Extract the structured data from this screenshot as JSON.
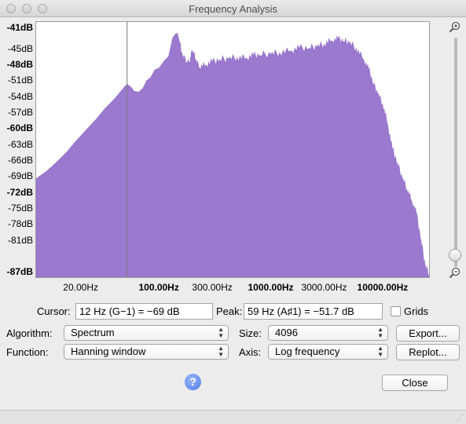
{
  "window": {
    "title": "Frequency Analysis"
  },
  "chart_data": {
    "type": "area",
    "xscale": "log",
    "xlim": [
      8,
      26000
    ],
    "ylim": [
      -88,
      -40
    ],
    "color": "#9b79cf",
    "cursor_hz": 12,
    "y_tick_labels": [
      {
        "value": -41,
        "label": "-41dB",
        "bold": true
      },
      {
        "value": -45,
        "label": "-45dB",
        "bold": false
      },
      {
        "value": -48,
        "label": "-48dB",
        "bold": true
      },
      {
        "value": -51,
        "label": "-51dB",
        "bold": false
      },
      {
        "value": -54,
        "label": "-54dB",
        "bold": false
      },
      {
        "value": -57,
        "label": "-57dB",
        "bold": false
      },
      {
        "value": -60,
        "label": "-60dB",
        "bold": true
      },
      {
        "value": -63,
        "label": "-63dB",
        "bold": false
      },
      {
        "value": -66,
        "label": "-66dB",
        "bold": false
      },
      {
        "value": -69,
        "label": "-69dB",
        "bold": false
      },
      {
        "value": -72,
        "label": "-72dB",
        "bold": true
      },
      {
        "value": -75,
        "label": "-75dB",
        "bold": false
      },
      {
        "value": -78,
        "label": "-78dB",
        "bold": false
      },
      {
        "value": -81,
        "label": "-81dB",
        "bold": false
      },
      {
        "value": -87,
        "label": "-87dB",
        "bold": true
      }
    ],
    "x_tick_labels": [
      {
        "value": 20,
        "label": "20.00Hz",
        "bold": false
      },
      {
        "value": 100,
        "label": "100.00Hz",
        "bold": true
      },
      {
        "value": 300,
        "label": "300.00Hz",
        "bold": false
      },
      {
        "value": 1000,
        "label": "1000.00Hz",
        "bold": true
      },
      {
        "value": 3000,
        "label": "3000.00Hz",
        "bold": false
      },
      {
        "value": 10000,
        "label": "10000.00Hz",
        "bold": true
      }
    ],
    "points": [
      [
        8,
        -69.5
      ],
      [
        10,
        -68
      ],
      [
        12,
        -66.5
      ],
      [
        15,
        -64.5
      ],
      [
        18,
        -62.5
      ],
      [
        22,
        -60.5
      ],
      [
        27,
        -58.5
      ],
      [
        33,
        -56.3
      ],
      [
        40,
        -54.5
      ],
      [
        48,
        -52.5
      ],
      [
        52,
        -51.7
      ],
      [
        56,
        -52.2
      ],
      [
        60,
        -53
      ],
      [
        66,
        -53.2
      ],
      [
        72,
        -52.5
      ],
      [
        78,
        -51
      ],
      [
        84,
        -50.5
      ],
      [
        92,
        -49
      ],
      [
        100,
        -48.7
      ],
      [
        112,
        -47.3
      ],
      [
        122,
        -46.5
      ],
      [
        133,
        -43
      ],
      [
        140,
        -42.3
      ],
      [
        146,
        -42.1
      ],
      [
        152,
        -43.5
      ],
      [
        162,
        -46.5
      ],
      [
        178,
        -47.5
      ],
      [
        188,
        -47.8
      ],
      [
        196,
        -46
      ],
      [
        204,
        -45.8
      ],
      [
        214,
        -47.5
      ],
      [
        232,
        -48.5
      ],
      [
        260,
        -48.2
      ],
      [
        300,
        -47.6
      ],
      [
        350,
        -47.1
      ],
      [
        420,
        -47
      ],
      [
        500,
        -46.7
      ],
      [
        600,
        -46.9
      ],
      [
        700,
        -46.4
      ],
      [
        800,
        -46.2
      ],
      [
        1000,
        -46.1
      ],
      [
        1200,
        -45.8
      ],
      [
        1500,
        -45.5
      ],
      [
        1800,
        -45
      ],
      [
        2200,
        -44.9
      ],
      [
        2600,
        -44.7
      ],
      [
        3000,
        -44.2
      ],
      [
        3500,
        -43.6
      ],
      [
        4000,
        -43.3
      ],
      [
        4500,
        -43.6
      ],
      [
        5000,
        -44
      ],
      [
        5800,
        -45
      ],
      [
        6700,
        -47
      ],
      [
        7500,
        -49
      ],
      [
        8200,
        -51.5
      ],
      [
        9000,
        -53.5
      ],
      [
        10000,
        -55.5
      ],
      [
        11000,
        -59
      ],
      [
        12200,
        -64
      ],
      [
        13500,
        -66.5
      ],
      [
        15000,
        -69.5
      ],
      [
        16500,
        -71.5
      ],
      [
        18000,
        -73.5
      ],
      [
        20000,
        -76
      ],
      [
        22000,
        -81
      ],
      [
        24000,
        -86
      ],
      [
        26000,
        -87.5
      ]
    ]
  },
  "controls": {
    "cursor_label": "Cursor:",
    "cursor_value": "12 Hz (G−1) = −69 dB",
    "peak_label": "Peak:",
    "peak_value": "59 Hz (A♯1) = −51.7 dB",
    "grids_label": "Grids",
    "algorithm_label": "Algorithm:",
    "algorithm_value": "Spectrum",
    "size_label": "Size:",
    "size_value": "4096",
    "function_label": "Function:",
    "function_value": "Hanning window",
    "axis_label": "Axis:",
    "axis_value": "Log frequency",
    "export_button": "Export...",
    "replot_button": "Replot...",
    "close_button": "Close",
    "help_glyph": "?"
  },
  "icons": {
    "zoom_in": "zoom-in-icon",
    "zoom_out": "zoom-out-icon"
  }
}
